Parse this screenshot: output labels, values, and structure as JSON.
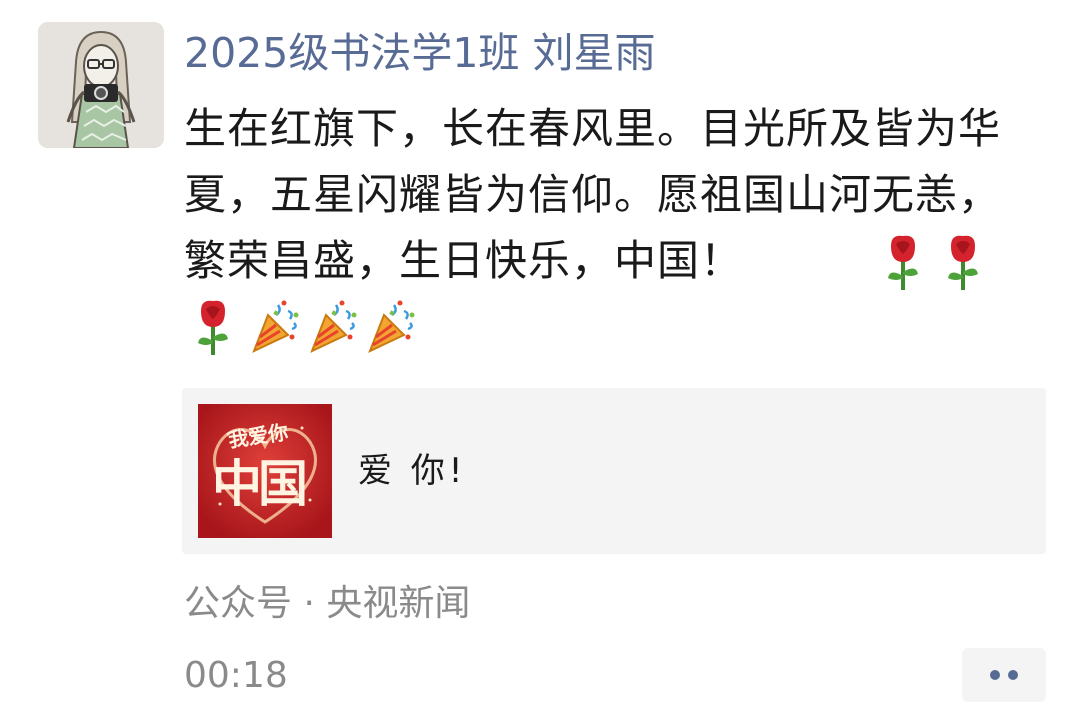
{
  "post": {
    "author": "2025级书法学1班  刘星雨",
    "text": "生在红旗下，长在春风里。目光所及皆为华夏，五星闪耀皆为信仰。愿祖国山河无恙，繁荣昌盛，生日快乐，中国！",
    "emojis": [
      "rose",
      "rose",
      "rose",
      "party-popper",
      "party-popper",
      "party-popper"
    ],
    "share_card": {
      "title": "爱 你!",
      "thumb_text_small": "我爱你",
      "thumb_text_big": "中国"
    },
    "source": "公众号 · 央视新闻",
    "time": "00:18"
  },
  "colors": {
    "name_link": "#576b95",
    "meta_gray": "#8a8a8a",
    "card_bg": "#f4f4f4",
    "thumb_red": "#c9262a"
  }
}
